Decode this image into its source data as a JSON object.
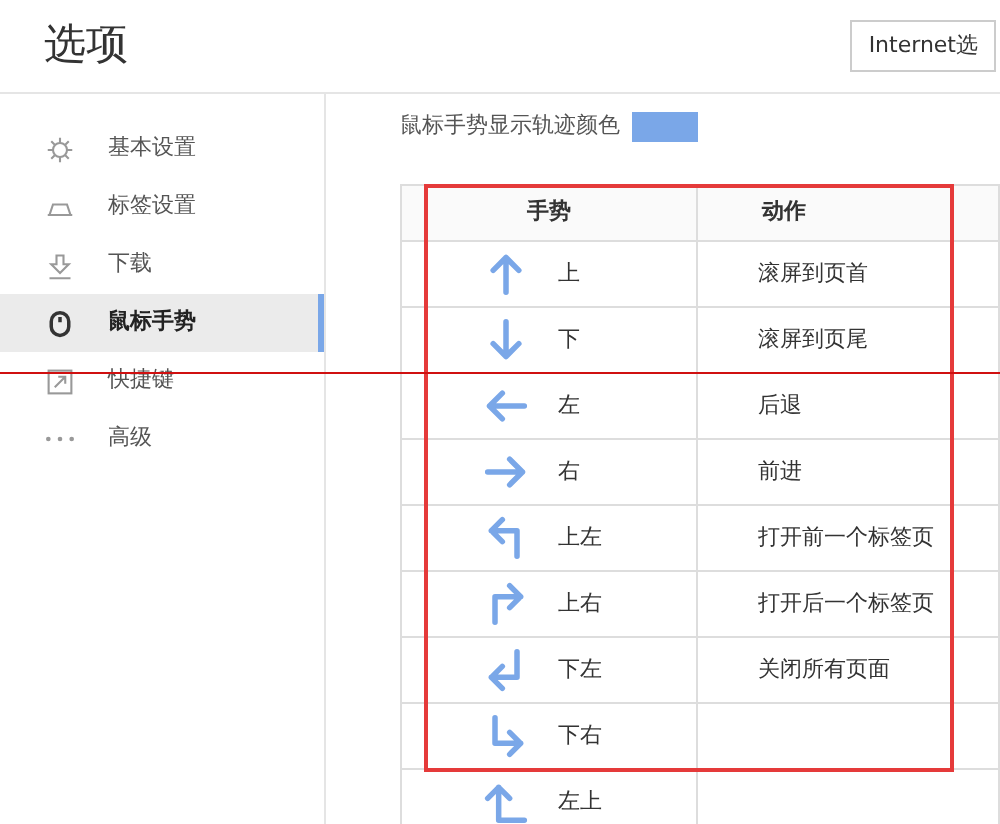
{
  "window": {
    "title": "选项"
  },
  "header_button": {
    "label": "Internet选"
  },
  "sidebar": {
    "items": [
      {
        "label": "基本设置",
        "kind": "gear",
        "selected": false
      },
      {
        "label": "标签设置",
        "kind": "tab",
        "selected": false
      },
      {
        "label": "下载",
        "kind": "download",
        "selected": false
      },
      {
        "label": "鼠标手势",
        "kind": "mouse",
        "selected": true
      },
      {
        "label": "快捷键",
        "kind": "shortcut",
        "selected": false
      },
      {
        "label": "高级",
        "kind": "dots",
        "selected": false
      }
    ]
  },
  "trail_color": {
    "label": "鼠标手势显示轨迹颜色",
    "color": "#7aa7e8"
  },
  "table": {
    "columns": [
      "手势",
      "动作"
    ],
    "rows": [
      {
        "kind": "up",
        "gesture": "上",
        "action": "滚屏到页首"
      },
      {
        "kind": "down",
        "gesture": "下",
        "action": "滚屏到页尾"
      },
      {
        "kind": "left",
        "gesture": "左",
        "action": "后退"
      },
      {
        "kind": "right",
        "gesture": "右",
        "action": "前进"
      },
      {
        "kind": "up-left",
        "gesture": "上左",
        "action": "打开前一个标签页"
      },
      {
        "kind": "up-right",
        "gesture": "上右",
        "action": "打开后一个标签页"
      },
      {
        "kind": "down-left",
        "gesture": "下左",
        "action": "关闭所有页面"
      },
      {
        "kind": "down-right",
        "gesture": "下右"
      },
      {
        "kind": "left-up",
        "gesture": "左上"
      }
    ]
  }
}
